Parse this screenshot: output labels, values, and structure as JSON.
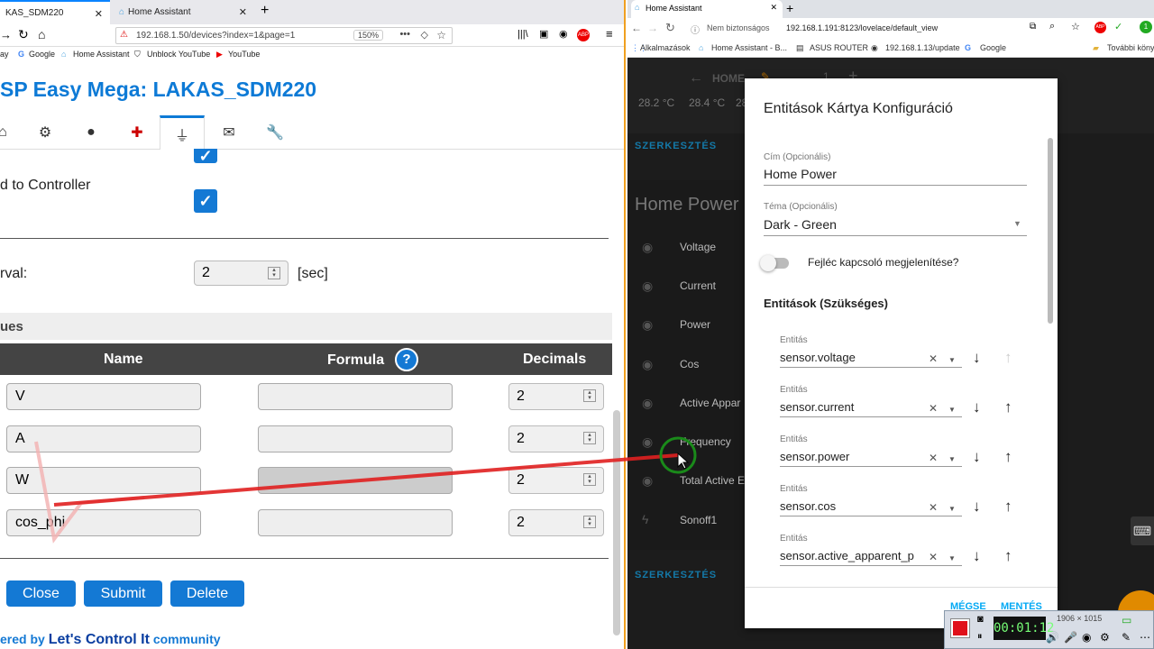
{
  "left_browser": {
    "tabs": [
      {
        "label": "KAS_SDM220"
      },
      {
        "label": "Home Assistant"
      }
    ],
    "url": "192.168.1.50/devices?index=1&page=1",
    "zoom": "150%",
    "bookmarks": [
      "ay",
      "Google",
      "Home Assistant",
      "Unblock YouTube",
      "YouTube"
    ],
    "page_title": "SP Easy Mega: LAKAS_SDM220",
    "send_to_controller": "d to Controller",
    "interval_label": "rval:",
    "interval_value": "2",
    "interval_unit": "[sec]",
    "values_section": "ues",
    "table_headers": {
      "name": "Name",
      "formula": "Formula",
      "decimals": "Decimals"
    },
    "rows": [
      {
        "name": "V",
        "decimals": "2"
      },
      {
        "name": "A",
        "decimals": "2"
      },
      {
        "name": "W",
        "decimals": "2"
      },
      {
        "name": "cos_phi",
        "decimals": "2"
      }
    ],
    "buttons": {
      "close": "Close",
      "submit": "Submit",
      "delete": "Delete"
    },
    "footer_prefix": "ered by",
    "footer_link": "Let's Control It",
    "footer_suffix": "community"
  },
  "right_browser": {
    "tab_label": "Home Assistant",
    "security": "Nem biztonságos",
    "url": "192.168.1.191:8123/lovelace/default_view",
    "bookmarks": [
      "Alkalmazások",
      "Home Assistant - B...",
      "ASUS ROUTER",
      "192.168.1.13/update",
      "Google",
      "További könyv"
    ],
    "ha_title": "HOME",
    "ha_count": "1",
    "temps": [
      "28.2 °C",
      "28.4 °C",
      "28"
    ],
    "edit_label": "SZERKESZTÉS",
    "card_title": "Home Power",
    "card_rows": [
      "Voltage",
      "Current",
      "Power",
      "Cos",
      "Active Appar",
      "Frequency",
      "Total Active E",
      "Sonoff1"
    ],
    "dialog": {
      "title": "Entitások Kártya Konfiguráció",
      "cim_label": "Cím (Opcionális)",
      "cim_value": "Home Power",
      "tema_label": "Téma (Opcionális)",
      "tema_value": "Dark - Green",
      "toggle_label": "Fejléc kapcsoló megjelenítése?",
      "entities_header": "Entitások (Szükséges)",
      "entity_label": "Entitás",
      "entities": [
        "sensor.voltage",
        "sensor.current",
        "sensor.power",
        "sensor.cos",
        "sensor.active_apparent_p"
      ],
      "cancel": "MÉGSE",
      "save": "MENTÉS"
    }
  },
  "recorder": {
    "time": "00:01:12",
    "size": "1906 × 1015"
  },
  "colors": {
    "esp_blue": "#0d7ad6",
    "ha_blue": "#03a9f4",
    "record_red": "#e0101a"
  }
}
